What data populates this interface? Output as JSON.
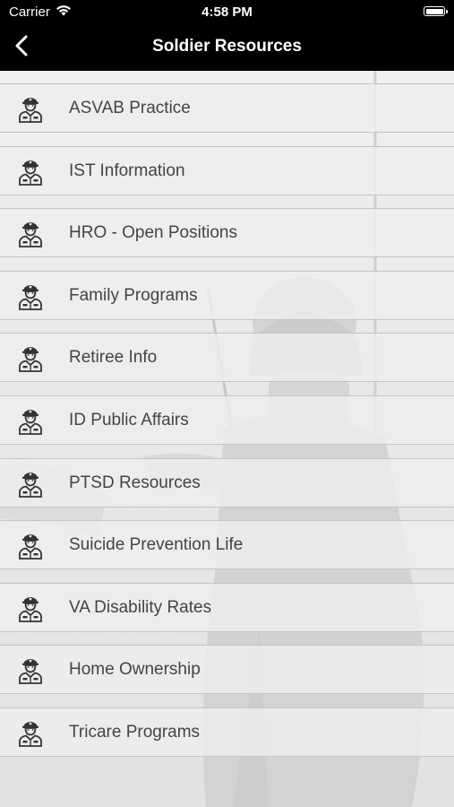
{
  "status_bar": {
    "carrier": "Carrier",
    "time": "4:58 PM",
    "wifi_icon": "wifi-icon",
    "battery_icon": "battery-full-icon"
  },
  "nav": {
    "title": "Soldier Resources",
    "back_icon": "chevron-left-icon"
  },
  "items": [
    {
      "label": "ASVAB Practice",
      "icon": "soldier-icon"
    },
    {
      "label": "IST Information",
      "icon": "soldier-icon"
    },
    {
      "label": "HRO - Open Positions",
      "icon": "soldier-icon"
    },
    {
      "label": "Family Programs",
      "icon": "soldier-icon"
    },
    {
      "label": "Retiree Info",
      "icon": "soldier-icon"
    },
    {
      "label": "ID Public Affairs",
      "icon": "soldier-icon"
    },
    {
      "label": "PTSD Resources",
      "icon": "soldier-icon"
    },
    {
      "label": "Suicide Prevention Life",
      "icon": "soldier-icon"
    },
    {
      "label": "VA Disability Rates",
      "icon": "soldier-icon"
    },
    {
      "label": "Home Ownership",
      "icon": "soldier-icon"
    },
    {
      "label": "Tricare Programs",
      "icon": "soldier-icon"
    }
  ],
  "colors": {
    "bar_background": "#000000",
    "bar_text": "#ffffff",
    "row_text": "#444444",
    "row_border": "#c4c4c4"
  }
}
